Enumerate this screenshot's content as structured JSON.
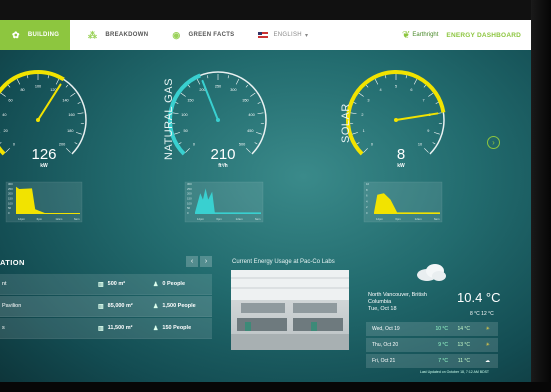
{
  "nav": {
    "tabs": [
      {
        "label": "BUILDING",
        "icon": "building-icon",
        "active": true
      },
      {
        "label": "BREAKDOWN",
        "icon": "breakdown-icon",
        "active": false
      },
      {
        "label": "GREEN FACTS",
        "icon": "globe-icon",
        "active": false
      }
    ],
    "language": "ENGLISH",
    "brand": "Earthright",
    "dashboard_title": "ENERGY DASHBOARD"
  },
  "gauges": [
    {
      "name": "electricity",
      "label": "",
      "value": "126",
      "unit": "kW",
      "ticks": [
        "0",
        "20",
        "40",
        "60",
        "80",
        "100",
        "120",
        "140",
        "160",
        "180",
        "200"
      ],
      "fraction": 0.62,
      "accent": "#f2e300"
    },
    {
      "name": "natural-gas",
      "label": "NATURAL GAS",
      "value": "210",
      "unit": "ft³/h",
      "ticks": [
        "0",
        "50",
        "100",
        "150",
        "200",
        "250",
        "300",
        "350",
        "400",
        "450",
        "500"
      ],
      "fraction": 0.42,
      "accent": "#39d0d0"
    },
    {
      "name": "solar",
      "label": "SOLAR",
      "value": "8",
      "unit": "kW",
      "ticks": [
        "0",
        "1",
        "2",
        "3",
        "4",
        "5",
        "6",
        "7",
        "8",
        "9",
        "10"
      ],
      "fraction": 0.8,
      "accent": "#f2e300"
    }
  ],
  "mini_charts": [
    {
      "yticks": [
        "300",
        "250",
        "200",
        "150",
        "100",
        "50",
        "0"
      ],
      "xticks": [
        "12pm",
        "6pm",
        "12am",
        "6am"
      ]
    },
    {
      "yticks": [
        "300",
        "250",
        "200",
        "150",
        "100",
        "50",
        "0"
      ],
      "xticks": [
        "12pm",
        "6pm",
        "12am",
        "6am"
      ]
    },
    {
      "yticks": [
        "10",
        "8",
        "6",
        "4",
        "2",
        "0"
      ],
      "xticks": [
        "12pm",
        "6pm",
        "12am",
        "6am"
      ]
    }
  ],
  "buildings": {
    "heading": "ATION",
    "rows": [
      {
        "name": "nt",
        "area": "500 m²",
        "people": "0 People"
      },
      {
        "name": "Pavilion",
        "area": "85,000 m²",
        "people": "1,500 People"
      },
      {
        "name": "s",
        "area": "11,500 m²",
        "people": "150 People"
      }
    ]
  },
  "photo": {
    "title": "Current Energy Usage at Pac-Co Labs"
  },
  "weather": {
    "location": "North Vancouver, British Columbia",
    "date": "Tue, Oct 18",
    "temp": "10.4 °C",
    "range": "8 °C  12 °C",
    "forecast": [
      {
        "day": "Wed, Oct 19",
        "lo": "10 °C",
        "hi": "14 °C",
        "icon": "partly-sunny-icon"
      },
      {
        "day": "Thu, Oct 20",
        "lo": "9 °C",
        "hi": "13 °C",
        "icon": "partly-sunny-icon"
      },
      {
        "day": "Fri, Oct 21",
        "lo": "7 °C",
        "hi": "11 °C",
        "icon": "cloud-icon"
      }
    ],
    "updated": "Last Updated on October 18, 7:12 AM BDST"
  }
}
